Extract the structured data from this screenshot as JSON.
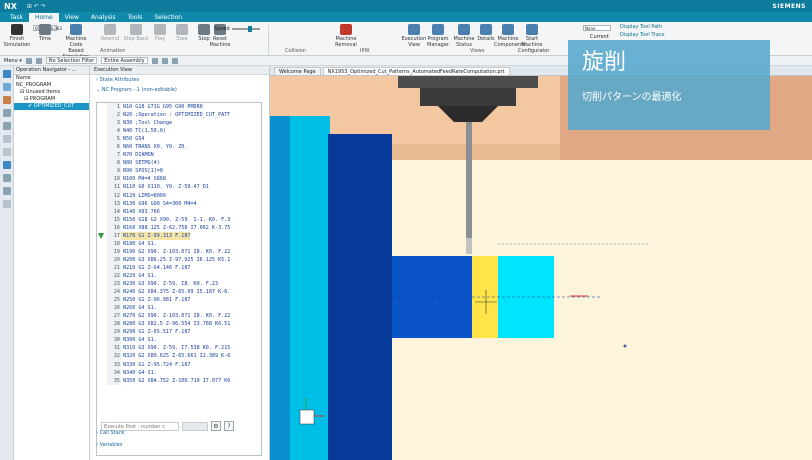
{
  "app": {
    "name": "NX",
    "brand": "SIEMENS",
    "quick_access": "⊞ ↶ ↷"
  },
  "menu": {
    "tabs": [
      "Task",
      "Home",
      "View",
      "Analysis",
      "Tools",
      "Selection"
    ],
    "active": "Home"
  },
  "ribbon": {
    "time_value": "00:00:18.063",
    "buttons": [
      {
        "label": "Finish Simulation",
        "icon": "checkered-flag-icon",
        "color": "#333333",
        "dim": false
      },
      {
        "label": "Time",
        "icon": "clock-icon",
        "color": "#6b7a85",
        "dim": false
      },
      {
        "label": "Machine Code Based Simulation",
        "icon": "machine-code-icon",
        "color": "#4a7fb0",
        "dim": false
      },
      {
        "label": "Rewind",
        "icon": "rewind-icon",
        "color": "#b0b6bb",
        "dim": true
      },
      {
        "label": "Step Back",
        "icon": "step-back-icon",
        "color": "#b0b6bb",
        "dim": true
      },
      {
        "label": "Play",
        "icon": "play-icon",
        "color": "#b0b6bb",
        "dim": true
      },
      {
        "label": "Step",
        "icon": "step-icon",
        "color": "#b0b6bb",
        "dim": true
      },
      {
        "label": "Stop",
        "icon": "stop-icon",
        "color": "#6b7a85",
        "dim": false
      },
      {
        "label": "Reset Machine",
        "icon": "reset-icon",
        "color": "#6b7a85",
        "dim": false
      }
    ],
    "speed_label": "Speed",
    "right_buttons": [
      {
        "label": "Machine Removal",
        "icon": "material-removal-icon",
        "color": "#c0392b",
        "dim": false
      },
      {
        "label": "Execution View",
        "icon": "execution-view-icon",
        "color": "#4a7fb0",
        "dim": false
      },
      {
        "label": "Program Manager",
        "icon": "program-manager-icon",
        "color": "#4a7fb0",
        "dim": false
      },
      {
        "label": "Machine Status",
        "icon": "machine-status-icon",
        "color": "#4a7fb0",
        "dim": false
      },
      {
        "label": "Details",
        "icon": "details-icon",
        "color": "#4a7fb0",
        "dim": false
      },
      {
        "label": "Machine Components",
        "icon": "machine-components-icon",
        "color": "#4a7fb0",
        "dim": false
      },
      {
        "label": "Start Machine Configurator",
        "icon": "configurator-icon",
        "color": "#4a7fb0",
        "dim": false
      }
    ],
    "groups": [
      "Animation",
      "Collision",
      "IPW",
      "Views"
    ],
    "current_label": "Current",
    "none_value": "None",
    "side_options": [
      "Display Tool Path",
      "Display Tool Trace"
    ]
  },
  "selection_bar": {
    "menu": "Menu ▾",
    "filter": "No Selection Filter",
    "assembly": "Entire Assembly"
  },
  "navigator": {
    "title": "Operation Navigator - ...",
    "rows": [
      {
        "text": "Name",
        "indent": 0,
        "selected": false
      },
      {
        "text": "NC_PROGRAM",
        "indent": 0,
        "selected": false
      },
      {
        "text": "⊟ Unused Items",
        "indent": 1,
        "selected": false
      },
      {
        "text": "⊟ PROGRAM",
        "indent": 2,
        "selected": false
      },
      {
        "text": "✔ OPTIMIZED_CUT",
        "indent": 3,
        "selected": true
      }
    ]
  },
  "execution_view": {
    "title": "Execution View",
    "state_attributes": "State Attributes",
    "nc_program": "NC Program - 1 (non-editable)",
    "lines": [
      {
        "num": "1",
        "code": "N10 G18 G71G G95 G90 PMDR0"
      },
      {
        "num": "2",
        "code": "N20 ;Operation : OPTIMIZED_CUT_PATT"
      },
      {
        "num": "3",
        "code": "N30 ;Tool Change"
      },
      {
        "num": "4",
        "code": "N40 TC(1,50,0)"
      },
      {
        "num": "5",
        "code": "N50 G54"
      },
      {
        "num": "6",
        "code": "N60 TRANS X0. Y0. Z0."
      },
      {
        "num": "7",
        "code": "N70 DIAMON"
      },
      {
        "num": "8",
        "code": "N80 SETMS(4)"
      },
      {
        "num": "9",
        "code": "N90 SPOS[1]=0"
      },
      {
        "num": "10",
        "code": "N100 M4=4 S868"
      },
      {
        "num": "11",
        "code": "N110 G0 X110. Y0. Z-59.47 D1"
      },
      {
        "num": "12",
        "code": "N120 LIMS=8000"
      },
      {
        "num": "13",
        "code": "N130 G96 G90 S4=300 M4=4"
      },
      {
        "num": "14",
        "code": "N140 X93.766"
      },
      {
        "num": "15",
        "code": "N150 G18 G2 X90. Z-59. I-1. K0. F.3"
      },
      {
        "num": "16",
        "code": "N160 X88.125 Z-62.758 I7.062 K-3.75"
      },
      {
        "num": "17",
        "code": "N170 G1 Z-99.313 F.187",
        "current": true
      },
      {
        "num": "18",
        "code": "N180 G4 S1."
      },
      {
        "num": "19",
        "code": "N190 G2 X90. Z-103.071 I8. K0. F.22"
      },
      {
        "num": "20",
        "code": "N200 G3 X86.25 Z-97.925 I6.125 K5.1"
      },
      {
        "num": "21",
        "code": "N210 G1 Z-64.146 F.187"
      },
      {
        "num": "22",
        "code": "N220 G4 S1."
      },
      {
        "num": "23",
        "code": "N230 G3 X90. Z-59. I8. K0. F.23"
      },
      {
        "num": "24",
        "code": "N240 G2 X84.375 Z-65.09 I5.187 K-6."
      },
      {
        "num": "25",
        "code": "N250 G1 Z-96.981 F.187"
      },
      {
        "num": "26",
        "code": "N260 G4 S1."
      },
      {
        "num": "27",
        "code": "N270 G2 X90. Z-103.071 I8. K0. F.22"
      },
      {
        "num": "28",
        "code": "N280 G3 X82.5 Z-96.554 I3.788 K6.51"
      },
      {
        "num": "29",
        "code": "N290 G1 Z-65.517 F.187"
      },
      {
        "num": "30",
        "code": "N300 G4 S1."
      },
      {
        "num": "31",
        "code": "N310 G3 X90. Z-59. I7.538 K0. F.215"
      },
      {
        "num": "32",
        "code": "N320 G2 X80.625 Z-65.661 I2.389 K-6"
      },
      {
        "num": "33",
        "code": "N330 G1 Z-95.724 F.187"
      },
      {
        "num": "34",
        "code": "N340 G4 S1."
      },
      {
        "num": "35",
        "code": "N350 G2 X84.752 Z-100.719 I7.077 K6"
      }
    ],
    "execute_post_placeholder": "Execute Post - number c",
    "call_stack": "Call Stack",
    "variables": "Variables"
  },
  "doc_tabs": [
    "Welcome Page",
    "NX1953_Optimized_Cut_Patterns_AutomatedFeedRateComputation.prt"
  ],
  "overlay": {
    "title": "旋削",
    "subtitle": "切削パターンの最適化"
  },
  "colors": {
    "accent": "#0c7b9c",
    "cyan": "#00e5ff",
    "blue": "#0066dd",
    "yellow": "#ffe54a",
    "overlay": "#55a7cd"
  }
}
